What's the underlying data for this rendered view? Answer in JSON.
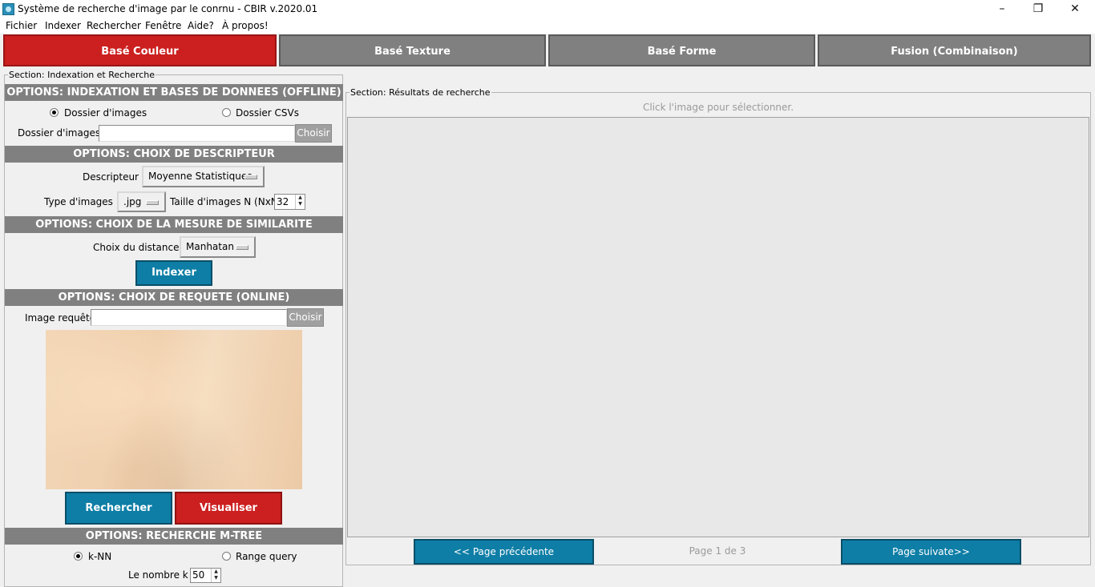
{
  "window": {
    "title": "Système de recherche d'image par le conrnu - CBIR v.2020.01",
    "minimize_glyph": "–",
    "restore_glyph": "❐",
    "close_glyph": "✕"
  },
  "menu": [
    "Fichier",
    "Indexer",
    "Rechercher",
    "Fenêtre",
    "Aide?",
    "À propos!"
  ],
  "tabs": [
    {
      "label": "Basé Couleur",
      "active": true
    },
    {
      "label": "Basé Texture",
      "active": false
    },
    {
      "label": "Basé Forme",
      "active": false
    },
    {
      "label": "Fusion (Combinaison)",
      "active": false
    }
  ],
  "left": {
    "section_title": "Section: Indexation et Recherche",
    "indexing_header": "OPTIONS: INDEXATION ET BASES DE DONNEES (OFFLINE)",
    "radio_images": "Dossier d'images",
    "radio_csvs": "Dossier CSVs",
    "radio_selected": "images",
    "folder_label": "Dossier d'images :",
    "folder_value": "",
    "choose_label": "Choisir",
    "descriptor_header": "OPTIONS: CHOIX DE DESCRIPTEUR",
    "descriptor_label": "Descripteur :",
    "descriptor_value": "Moyenne Statistiques",
    "image_type_label": "Type d'images :",
    "image_type_value": ".jpg",
    "image_size_label": "Taille d'images N (NxN):",
    "image_size_value": "32",
    "similarity_header": "OPTIONS: CHOIX DE LA MESURE DE SIMILARITE",
    "distance_label": "Choix du distance :",
    "distance_value": "Manhatan",
    "index_button": "Indexer",
    "query_header": "OPTIONS: CHOIX DE REQUETE (ONLINE)",
    "query_label": "Image requête:",
    "query_value": "",
    "query_choose": "Choisir",
    "search_button": "Rechercher",
    "visualize_button": "Visualiser",
    "mtree_header": "OPTIONS: RECHERCHE M-TREE",
    "radio_knn": "k-NN",
    "radio_range": "Range query",
    "k_label": "Le nombre k :",
    "k_value": "50"
  },
  "right": {
    "section_title": "Section: Résultats de recherche",
    "hint": "Click l'image pour sélectionner.",
    "prev_button": "<< Page précédente",
    "page_indicator": "Page 1 de 3",
    "next_button": "Page suivate>>"
  },
  "colors": {
    "accent_red": "#cc1f1f",
    "accent_blue": "#0e7ea6",
    "header_gray": "#808080"
  }
}
